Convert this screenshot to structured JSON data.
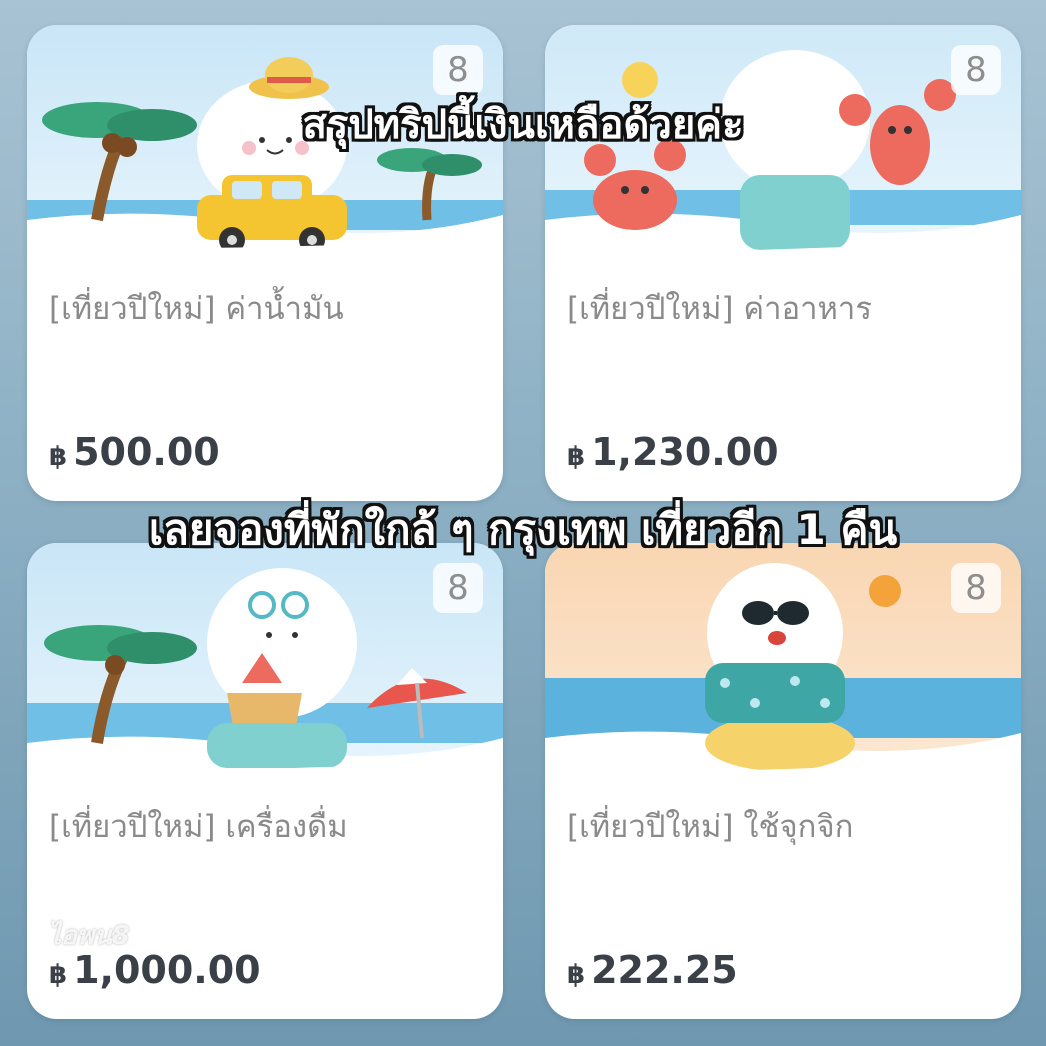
{
  "captions": {
    "top": "สรุปทริปนี้เงินเหลือด้วยค่ะ",
    "middle": "เลยจองที่พักใกล้ ๆ กรุงเทพ เที่ยวอีก 1 คืน"
  },
  "cards": [
    {
      "title": "[เที่ยวปีใหม่] ค่าน้ำมัน",
      "currency": "฿",
      "amount": "500.00",
      "member_count": "8",
      "scene": "car-beach-palm"
    },
    {
      "title": "[เที่ยวปีใหม่] ค่าอาหาร",
      "currency": "฿",
      "amount": "1,230.00",
      "member_count": "8",
      "scene": "crab-lobster-sea"
    },
    {
      "title": "[เที่ยวปีใหม่] เครื่องดื่ม",
      "currency": "฿",
      "amount": "1,000.00",
      "member_count": "8",
      "scene": "drink-palm-umbrella"
    },
    {
      "title": "[เที่ยวปีใหม่] ใช้จุกจิก",
      "currency": "฿",
      "amount": "222.25",
      "member_count": "8",
      "scene": "sunglasses-float-sunset"
    }
  ],
  "watermark": "ไอพน8",
  "colors": {
    "background": "#8db0c4",
    "card": "#ffffff",
    "amount_text": "#3a3f48",
    "title_text": "#8a8a8a"
  }
}
